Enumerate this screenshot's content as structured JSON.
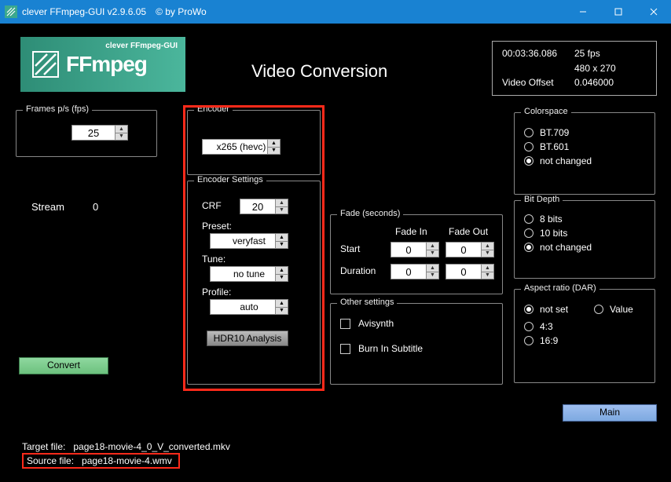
{
  "window": {
    "title": "clever FFmpeg-GUI v2.9.6.05",
    "copyright": "© by ProWo"
  },
  "logo": {
    "small_text": "clever FFmpeg-GUI",
    "brand": "FFmpeg"
  },
  "page_title": "Video Conversion",
  "info": {
    "duration": "00:03:36.086",
    "offset_label": "Video Offset",
    "fps": "25 fps",
    "resolution": "480 x 270",
    "offset": "0.046000"
  },
  "fps_group": {
    "legend": "Frames p/s (fps)",
    "value": "25"
  },
  "stream": {
    "label": "Stream",
    "value": "0"
  },
  "encoder": {
    "legend": "Encoder",
    "value": "x265 (hevc)"
  },
  "encset": {
    "legend": "Encoder Settings",
    "crf_label": "CRF",
    "crf": "20",
    "preset_label": "Preset:",
    "preset": "veryfast",
    "tune_label": "Tune:",
    "tune": "no tune",
    "profile_label": "Profile:",
    "profile": "auto",
    "hdr_btn": "HDR10 Analysis"
  },
  "fade": {
    "legend": "Fade (seconds)",
    "in_label": "Fade In",
    "out_label": "Fade Out",
    "start_label": "Start",
    "dur_label": "Duration",
    "start_in": "0",
    "start_out": "0",
    "dur_in": "0",
    "dur_out": "0"
  },
  "other": {
    "legend": "Other settings",
    "avisynth": "Avisynth",
    "burn": "Burn In Subtitle"
  },
  "cspace": {
    "legend": "Colorspace",
    "opts": [
      "BT.709",
      "BT.601",
      "not changed"
    ],
    "selected": 2
  },
  "depth": {
    "legend": "Bit Depth",
    "opts": [
      "8 bits",
      "10 bits",
      "not changed"
    ],
    "selected": 2
  },
  "dar": {
    "legend": "Aspect ratio (DAR)",
    "notset": "not set",
    "value": "Value",
    "r43": "4:3",
    "r169": "16:9",
    "selected": "notset"
  },
  "buttons": {
    "convert": "Convert",
    "main": "Main"
  },
  "files": {
    "target_label": "Target file:",
    "target": "page18-movie-4_0_V_converted.mkv",
    "source_label": "Source file:",
    "source": "page18-movie-4.wmv"
  }
}
